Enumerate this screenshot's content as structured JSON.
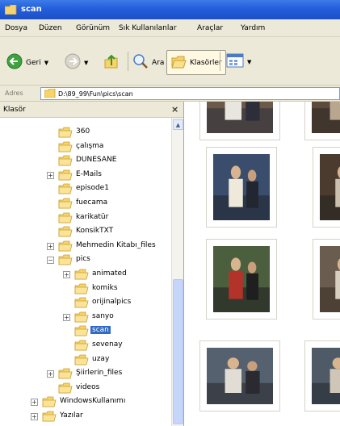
{
  "window": {
    "title": "scan"
  },
  "menu": [
    "Dosya",
    "Düzen",
    "Görünüm",
    "Sık Kullanılanlar",
    "Araçlar",
    "Yardım"
  ],
  "toolbar": {
    "back_label": "Geri",
    "search_label": "Ara",
    "folders_label": "Klasörler"
  },
  "address": {
    "label": "Adres",
    "path": "D:\\89_99\\Fun\\pics\\scan"
  },
  "folder_pane": {
    "title": "Klasör",
    "close_glyph": "×",
    "items": [
      {
        "label": "360",
        "expandable": false,
        "selected": false
      },
      {
        "label": "çalışma",
        "expandable": false,
        "selected": false
      },
      {
        "label": "DUNESANE",
        "expandable": false,
        "selected": false
      },
      {
        "label": "E-Mails",
        "expandable": true,
        "expander": "+",
        "selected": false
      },
      {
        "label": "episode1",
        "expandable": false,
        "selected": false
      },
      {
        "label": "fuecama",
        "expandable": false,
        "selected": false
      },
      {
        "label": "karikatür",
        "expandable": false,
        "selected": false
      },
      {
        "label": "KonsikTXT",
        "expandable": false,
        "selected": false
      },
      {
        "label": "Mehmedin Kitabı_files",
        "expandable": true,
        "expander": "+",
        "selected": false
      },
      {
        "label": "pics",
        "expandable": true,
        "expander": "−",
        "selected": false
      },
      {
        "label": "animated",
        "expandable": true,
        "expander": "+",
        "selected": false
      },
      {
        "label": "komiks",
        "expandable": false,
        "selected": false
      },
      {
        "label": "orijinalpics",
        "expandable": false,
        "selected": false
      },
      {
        "label": "sanyo",
        "expandable": true,
        "expander": "+",
        "selected": false
      },
      {
        "label": "scan",
        "expandable": false,
        "selected": true
      },
      {
        "label": "sevenay",
        "expandable": false,
        "selected": false
      },
      {
        "label": "uzay",
        "expandable": false,
        "selected": false
      },
      {
        "label": "Şiirlerin_files",
        "expandable": true,
        "expander": "+",
        "selected": false
      },
      {
        "label": "videos",
        "expandable": false,
        "selected": false
      },
      {
        "label": "WindowsKullanımı",
        "expandable": true,
        "expander": "+",
        "selected": false
      },
      {
        "label": "Yazılar",
        "expandable": true,
        "expander": "+",
        "selected": false
      }
    ]
  },
  "thumbnails": [
    "photo 1",
    "photo 2",
    "photo 3",
    "photo 4",
    "photo 5",
    "photo 6",
    "photo 7",
    "photo 8"
  ],
  "colors": {
    "titlebar": "#245edb",
    "selection": "#316ac5",
    "chrome": "#ece9d8"
  }
}
